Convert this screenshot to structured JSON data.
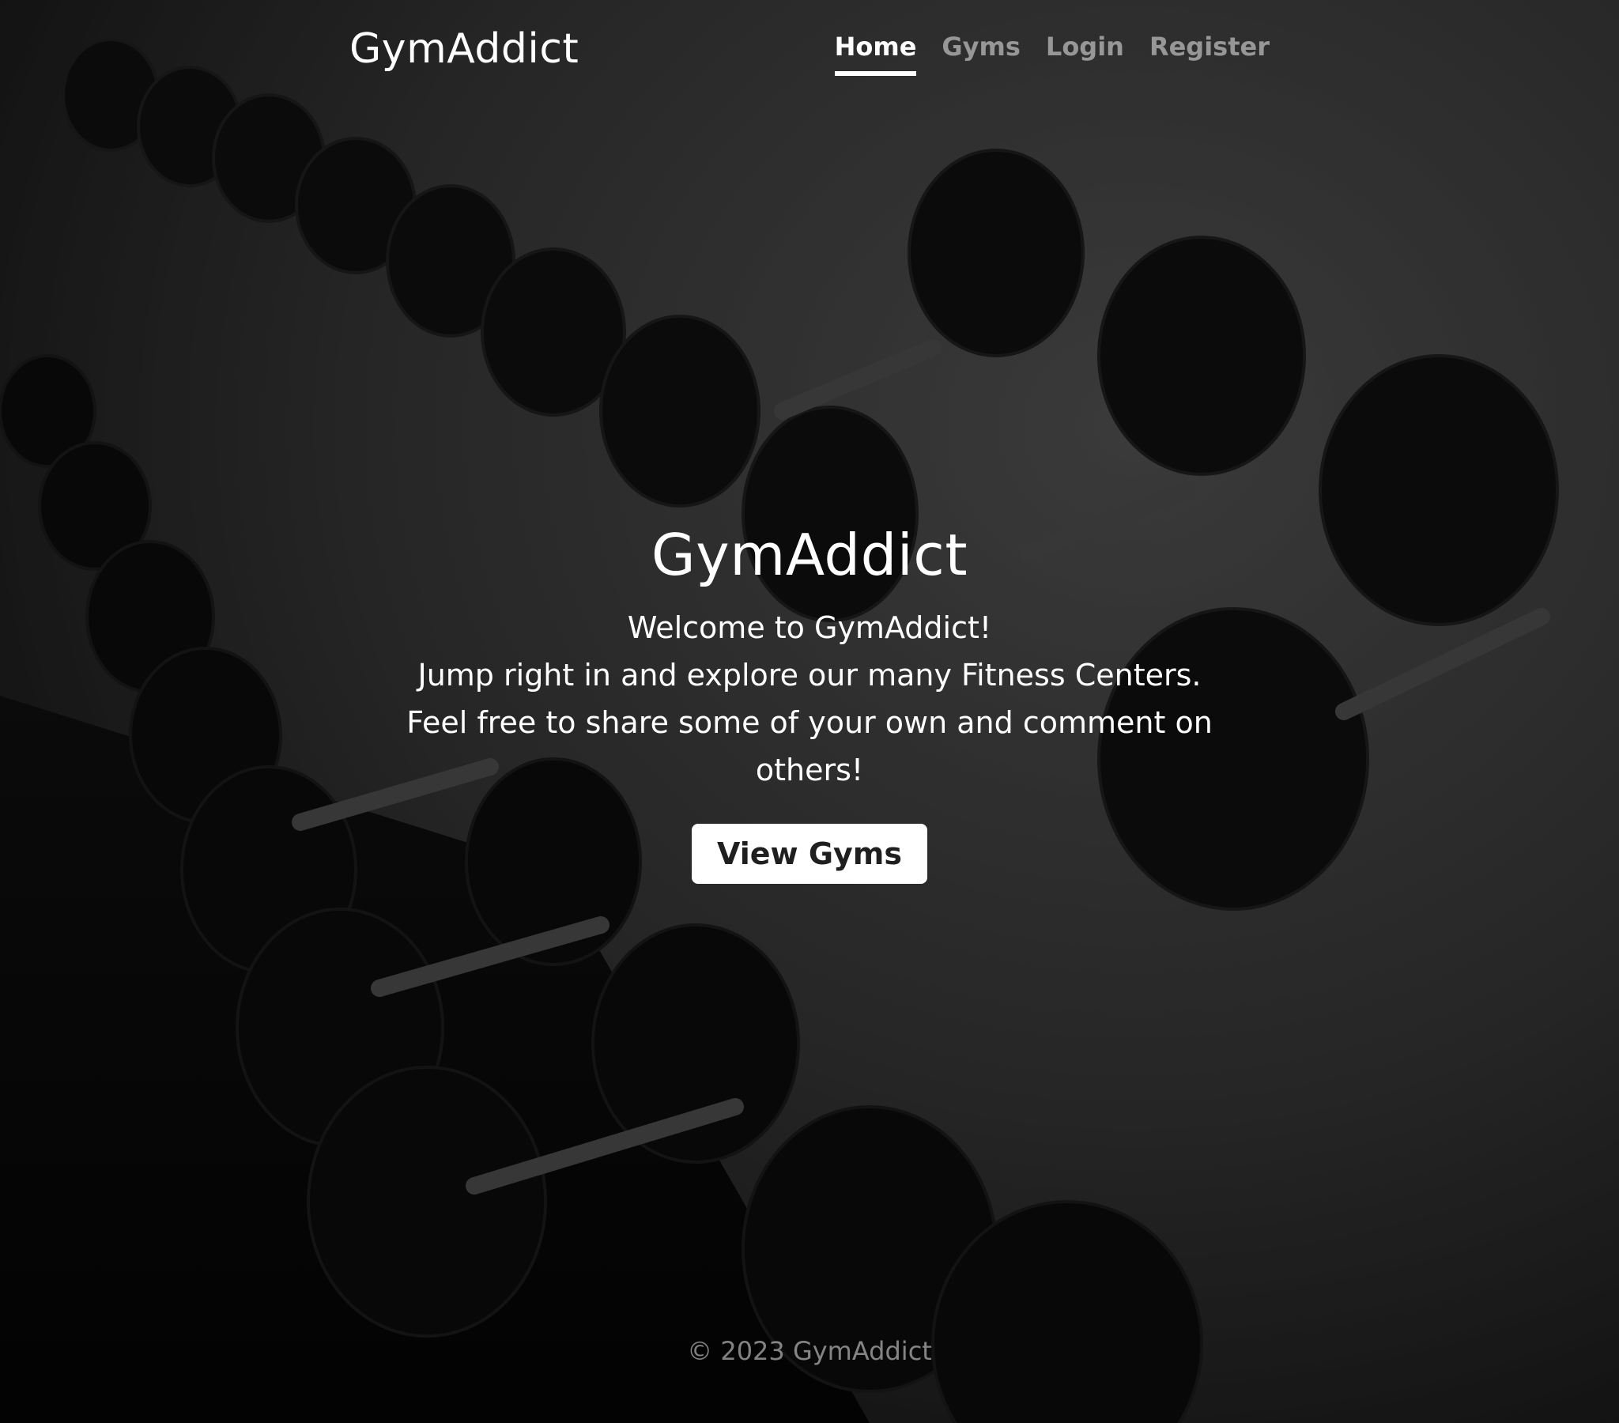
{
  "header": {
    "brand": "GymAddict",
    "nav": [
      {
        "label": "Home",
        "active": true
      },
      {
        "label": "Gyms",
        "active": false
      },
      {
        "label": "Login",
        "active": false
      },
      {
        "label": "Register",
        "active": false
      }
    ]
  },
  "hero": {
    "title": "GymAddict",
    "lead": [
      "Welcome to GymAddict!",
      "Jump right in and explore our many Fitness Centers.",
      "Feel free to share some of your own and comment on others!"
    ],
    "cta_label": "View Gyms"
  },
  "footer": {
    "text": "© 2023 GymAddict"
  },
  "colors": {
    "text": "#ffffff",
    "muted": "rgba(255,255,255,0.5)",
    "button_bg": "#ffffff",
    "button_text": "#1f1f1f"
  },
  "background": {
    "subject": "dumbbell rack photo, black and white"
  }
}
